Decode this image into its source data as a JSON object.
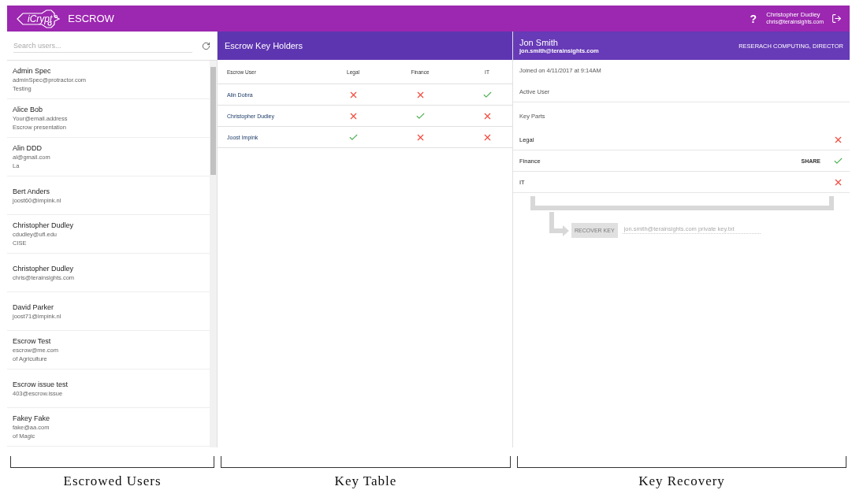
{
  "header": {
    "logo_text": "iCrypt",
    "title": "ESCROW",
    "help": "?",
    "user_name": "Christopher Dudley",
    "user_email": "chris@terainsights.com"
  },
  "search": {
    "placeholder": "Search users..."
  },
  "users": [
    {
      "name": "Admin Spec",
      "email": "adminSpec@protractor.com",
      "note": "Testing"
    },
    {
      "name": "Alice Bob",
      "email": "Your@email.address",
      "note": "Escrow presentation"
    },
    {
      "name": "Alin DDD",
      "email": "al@gmail.com",
      "note": "La"
    },
    {
      "name": "Bert Anders",
      "email": "joost60@impink.nl"
    },
    {
      "name": "Christopher Dudley",
      "email": "cdudley@ufl.edu",
      "note": "CISE"
    },
    {
      "name": "Christopher Dudley",
      "email": "chris@terainsights.com"
    },
    {
      "name": "David Parker",
      "email": "joost71@impink.nl"
    },
    {
      "name": "Escrow Test",
      "email": "escrow@me.com",
      "note": "of Agriculture"
    },
    {
      "name": "Escrow issue test",
      "email": "403@escrow.issue"
    },
    {
      "name": "Fakey Fake",
      "email": "fake@aa.com",
      "note": "of Magic"
    }
  ],
  "key_table": {
    "title": "Escrow Key Holders",
    "columns": [
      "Escrow User",
      "Legal",
      "Finance",
      "IT"
    ],
    "rows": [
      {
        "user": "Alin Dobra",
        "legal": false,
        "finance": false,
        "it": true
      },
      {
        "user": "Christopher Dudley",
        "legal": false,
        "finance": true,
        "it": false
      },
      {
        "user": "Joost Impink",
        "legal": true,
        "finance": false,
        "it": false
      }
    ]
  },
  "detail": {
    "name": "Jon Smith",
    "email": "jon.smith@terainsights.com",
    "role": "RESERACH COMPUTING, DIRECTOR",
    "joined": "Joined on 4/11/2017 at 9:14AM",
    "status": "Active User",
    "parts_title": "Key Parts",
    "parts": [
      {
        "label": "Legal",
        "has": false
      },
      {
        "label": "Finance",
        "has": true,
        "action": "SHARE"
      },
      {
        "label": "IT",
        "has": false
      }
    ],
    "recover_button": "RECOVER KEY",
    "file_value": "jon.smith@terainsights.com private key.txt"
  },
  "captions": [
    "Escrowed Users",
    "Key Table",
    "Key Recovery"
  ]
}
